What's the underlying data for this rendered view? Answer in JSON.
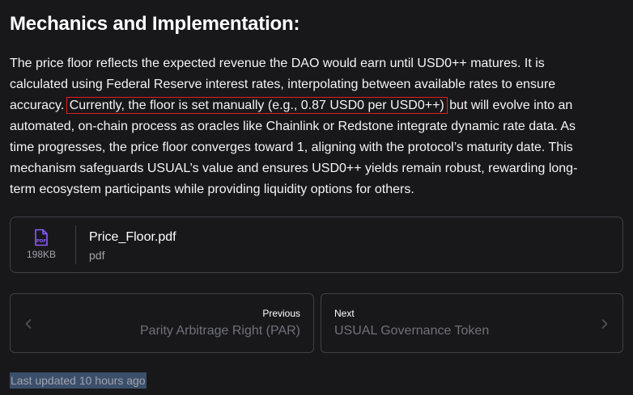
{
  "heading": "Mechanics and Implementation:",
  "paragraph": {
    "line1": "The price floor reflects the expected revenue the DAO would earn until USD0++ matures. It is",
    "line2": "calculated using Federal Reserve interest rates, interpolating between available rates to ensure",
    "line3_before": "accuracy.",
    "line3_highlight": "Currently, the floor is set manually (e.g., 0.87 USD0 per USD0++)",
    "line3_after": "but will evolve into an",
    "line4": "automated, on-chain process as oracles like Chainlink or Redstone integrate dynamic rate data. As",
    "line5": "time progresses, the price floor converges toward 1, aligning with the protocol’s maturity date. This",
    "line6": "mechanism safeguards USUAL’s value and ensures USD0++ yields remain robust, rewarding long-",
    "line7": "term ecosystem participants while providing liquidity options for others."
  },
  "attachment": {
    "icon": "pdf-file-icon",
    "size": "198KB",
    "name": "Price_Floor.pdf",
    "type": "pdf"
  },
  "navigation": {
    "previous": {
      "label": "Previous",
      "title": "Parity Arbitrage Right (PAR)",
      "icon": "chevron-left-icon"
    },
    "next": {
      "label": "Next",
      "title": "USUAL Governance Token",
      "icon": "chevron-right-icon"
    }
  },
  "last_updated": "Last updated 10 hours ago",
  "colors": {
    "background": "#18181b",
    "accent_icon": "#8b5cf6",
    "highlight_box": "#e01e1e",
    "selection": "#3b4f6b"
  }
}
